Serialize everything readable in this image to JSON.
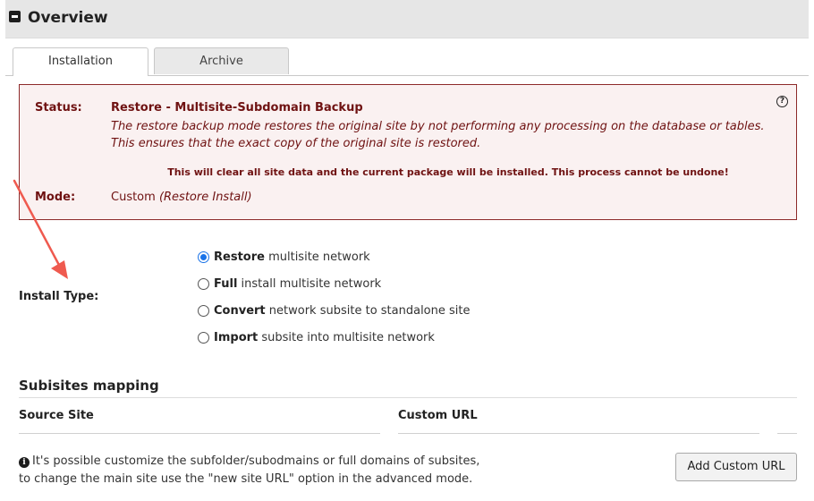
{
  "header": {
    "title": "Overview"
  },
  "tabs": [
    {
      "label": "Installation",
      "active": true
    },
    {
      "label": "Archive",
      "active": false
    }
  ],
  "status_box": {
    "status_label": "Status:",
    "status_value": "Restore - Multisite-Subdomain Backup",
    "description_line1": "The restore backup mode restores the original site by not performing any processing on the database or tables.",
    "description_line2": "This ensures that the exact copy of the original site is restored.",
    "warning": "This will clear all site data and the current package will be installed. This process cannot be undone!",
    "mode_label": "Mode:",
    "mode_value": "Custom",
    "mode_detail": "(Restore Install)",
    "help_icon": "question-circle-icon"
  },
  "install_type": {
    "label": "Install Type:",
    "options": [
      {
        "bold": "Restore",
        "rest": " multisite network",
        "checked": true
      },
      {
        "bold": "Full",
        "rest": " install multisite network",
        "checked": false
      },
      {
        "bold": "Convert",
        "rest": " network subsite to standalone site",
        "checked": false
      },
      {
        "bold": "Import",
        "rest": " subsite into multisite network",
        "checked": false
      }
    ]
  },
  "subsites": {
    "title": "Subisites mapping",
    "col_source": "Source Site",
    "col_custom": "Custom URL"
  },
  "info": {
    "icon": "info-circle-icon",
    "line1": "It's possible customize the subfolder/subodmains or full domains of subsites,",
    "line2": "to change the main site use the \"new site URL\" option in the advanced mode."
  },
  "add_button": {
    "label": "Add Custom URL"
  },
  "colors": {
    "status_text": "#6f1212",
    "status_border": "#8d2a2a",
    "status_bg": "#faf1f1",
    "radio_accent": "#1a73e8",
    "annotation_arrow": "#ef5a4f"
  }
}
